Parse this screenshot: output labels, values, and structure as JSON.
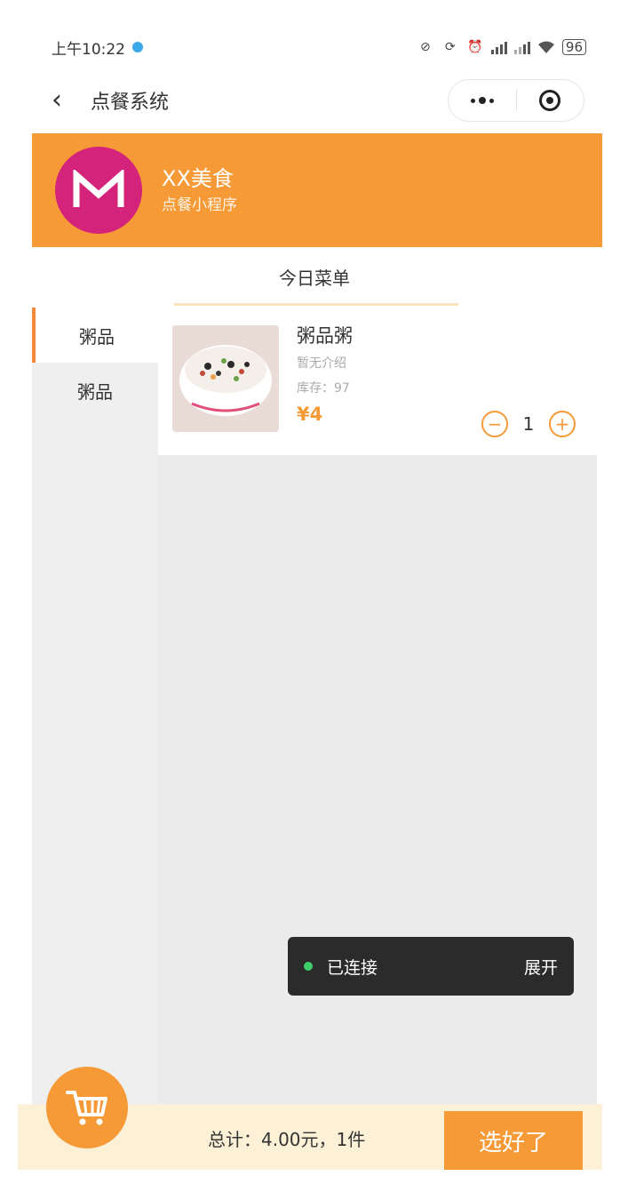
{
  "status_bar": {
    "time": "上午10:22",
    "battery": "96"
  },
  "nav": {
    "title": "点餐系统"
  },
  "shop": {
    "name": "XX美食",
    "subtitle": "点餐小程序",
    "logo_color": "#d4237a",
    "header_color": "#f59a37"
  },
  "tab": {
    "label": "今日菜单"
  },
  "categories": [
    {
      "label": "粥品",
      "active": true
    },
    {
      "label": "粥品",
      "active": false
    }
  ],
  "foods": [
    {
      "name": "粥品粥",
      "desc": "暂无介绍",
      "stock": "库存：97",
      "price": "¥4",
      "quantity": "1"
    }
  ],
  "toast": {
    "text": "已连接",
    "action": "展开"
  },
  "footer": {
    "total": "总计：4.00元，1件",
    "confirm_label": "选好了"
  },
  "colors": {
    "accent": "#f59a37",
    "active_indicator": "#f08a3a",
    "footer_bg": "#fcf1d6"
  }
}
